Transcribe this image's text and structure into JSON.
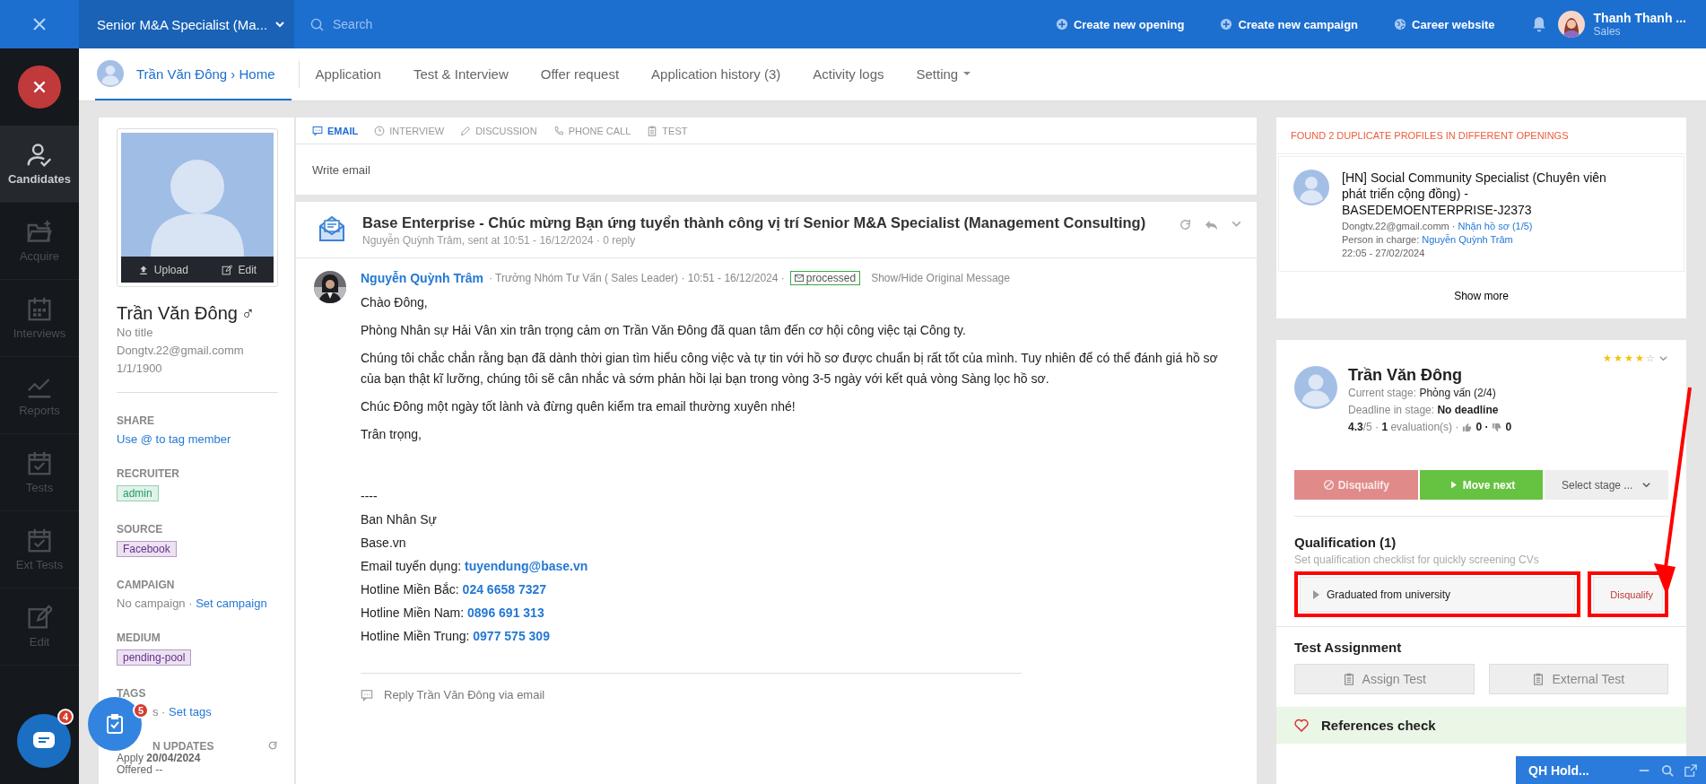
{
  "topbar": {
    "opening": "Senior M&A Specialist (Ma...",
    "search_placeholder": "Search",
    "actions": [
      {
        "label": "Create new opening",
        "kind": "plus"
      },
      {
        "label": "Create new campaign",
        "kind": "plus"
      },
      {
        "label": "Career website",
        "kind": "globe"
      }
    ],
    "user": {
      "name": "Thanh Thanh ...",
      "role": "Sales"
    }
  },
  "sidebar": {
    "items": [
      {
        "label": "Candidates",
        "kind": "user-check",
        "selected": true
      },
      {
        "label": "Acquire",
        "kind": "folder",
        "selected": false
      },
      {
        "label": "Interviews",
        "kind": "calendar",
        "selected": false
      },
      {
        "label": "Reports",
        "kind": "chart",
        "selected": false
      },
      {
        "label": "Tests",
        "kind": "calendar-check",
        "selected": false
      },
      {
        "label": "Ext Tests",
        "kind": "calendar-check",
        "selected": false
      },
      {
        "label": "Edit",
        "kind": "edit",
        "selected": false
      }
    ]
  },
  "subnav": {
    "tabs": [
      {
        "label": "Trần Văn Đông › Home",
        "kind": "profile",
        "selected": true
      },
      {
        "label": "Application",
        "kind": "link",
        "selected": false
      },
      {
        "label": "Test & Interview",
        "kind": "link",
        "selected": false
      },
      {
        "label": "Offer request",
        "kind": "link",
        "selected": false
      },
      {
        "label": "Application history (3)",
        "kind": "link",
        "selected": false
      },
      {
        "label": "Activity logs",
        "kind": "link",
        "selected": false
      },
      {
        "label": "Setting",
        "kind": "dropdown",
        "selected": false
      }
    ]
  },
  "profile": {
    "photo_actions": [
      {
        "label": "Upload",
        "kind": "upload"
      },
      {
        "label": "Edit",
        "kind": "edit"
      }
    ],
    "name": "Trần Văn Đông",
    "gender": "♂",
    "title": "No title",
    "email": "Dongtv.22@gmail.comm",
    "birthday": "1/1/1900",
    "sections": [
      {
        "heading": "SHARE",
        "kind": "link",
        "link": "Use @ to tag member"
      },
      {
        "heading": "RECRUITER",
        "kind": "tag",
        "tag": "admin",
        "color": "#1e9e63"
      },
      {
        "heading": "SOURCE",
        "kind": "tag",
        "tag": "Facebook",
        "color": "#6b2d8f"
      },
      {
        "heading": "CAMPAIGN",
        "kind": "text-link",
        "text": "No campaign ·",
        "link": "Set campaign"
      },
      {
        "heading": "MEDIUM",
        "kind": "tag",
        "tag": "pending-pool",
        "color": "#6b2d8f"
      },
      {
        "heading": "TAGS",
        "kind": "text-link",
        "text": "s ·",
        "link": "Set tags"
      },
      {
        "heading": "N UPDATES",
        "kind": "updates",
        "lines": [
          "Apply **20/04/2024**",
          "Offered --"
        ]
      }
    ]
  },
  "composer": {
    "tabs": [
      {
        "label": "EMAIL",
        "kind": "chat",
        "selected": true
      },
      {
        "label": "INTERVIEW",
        "kind": "clock",
        "selected": false
      },
      {
        "label": "DISCUSSION",
        "kind": "pencil",
        "selected": false
      },
      {
        "label": "PHONE CALL",
        "kind": "phone",
        "selected": false
      },
      {
        "label": "TEST",
        "kind": "clipboard",
        "selected": false
      }
    ],
    "placeholder": "Write email"
  },
  "email": {
    "subject": "Base Enterprise - Chúc mừng Bạn ứng tuyển thành công vị trí Senior M&A Specialist (Management Consulting)",
    "meta": "Nguyễn Quỳnh Trâm, sent at 10:51 - 16/12/2024 · 0 reply",
    "sender": "Nguyễn Quỳnh Trâm",
    "sender_info": "· Trưởng Nhóm Tư Vấn ( Sales Leader) · 10:51 - 16/12/2024 ·",
    "status": "processed",
    "toggle": "Show/Hide Original Message",
    "paragraphs": [
      "Chào Đông,",
      "Phòng Nhân sự Hải Vân xin trân trọng cảm ơn Trần Văn Đông đã quan tâm đến cơ hội công việc tại Công ty.",
      "Chúng tôi chắc chắn rằng bạn đã dành thời gian tìm hiểu công việc và tự tin với hồ sơ được chuẩn bị rất tốt của mình. Tuy nhiên để có thể đánh giá hồ sơ của bạn thật kĩ lưỡng, chúng tôi sẽ cân nhắc và sớm phản hồi lại bạn trong vòng 3-5 ngày với kết quả vòng Sàng lọc hồ sơ.",
      "Chúc Đông một ngày tốt lành và đừng quên kiểm tra email thường xuyên nhé!",
      "Trân trọng,"
    ],
    "signature": [
      {
        "label": "----"
      },
      {
        "label": "Ban Nhân Sự"
      },
      {
        "label": "Base.vn"
      },
      {
        "label": "Email tuyển dụng:",
        "value": "tuyendung@base.vn"
      },
      {
        "label": "Hotline Miền Bắc:",
        "value": "024 6658 7327"
      },
      {
        "label": "Hotline Miền Nam:",
        "value": "0896 691 313"
      },
      {
        "label": "Hotline Miền Trung:",
        "value": "0977 575 309"
      }
    ],
    "reply": "Reply Trần Văn Đông via email"
  },
  "duplicates": {
    "title": "FOUND 2 DUPLICATE PROFILES IN DIFFERENT OPENINGS",
    "items": [
      {
        "opening": "[HN] Social Community Specialist (Chuyên viên phát triển cộng đồng) - BASEDEMOENTERPRISE-J2373",
        "email": "Dongtv.22@gmail.comm ·",
        "stage": "Nhận hồ sơ (1/5)",
        "person_label": "Person in charge:",
        "person": "Nguyễn Quỳnh Trâm",
        "time": "22:05 - 27/02/2024"
      }
    ],
    "more": "Show more"
  },
  "candidate": {
    "stars": 4,
    "name": "Trần Văn Đông",
    "stage_label": "Current stage:",
    "stage": "Phỏng vấn (2/4)",
    "deadline_label": "Deadline in stage:",
    "deadline": "No deadline",
    "score": "4.3",
    "score_of": "/5 ·",
    "evaluations": "1",
    "evaluations_label": "evaluation(s) ·",
    "likes": "0 ·",
    "dislikes": "0",
    "buttons": [
      {
        "label": "Disqualify",
        "kind": "disqualify"
      },
      {
        "label": "Move next",
        "kind": "next"
      },
      {
        "label": "Select stage ...",
        "kind": "select"
      }
    ],
    "qualification": {
      "title": "Qualification (1)",
      "hint": "Set qualification checklist for quickly screening CVs",
      "items": [
        {
          "label": "Graduated from university",
          "action": "Disqualify",
          "highlighted": true
        }
      ]
    },
    "tests": {
      "title": "Test Assignment",
      "buttons": [
        "Assign Test",
        "External Test"
      ]
    },
    "references": "References check"
  },
  "fabs": {
    "chat_badge": "4",
    "tasks_badge": "5"
  },
  "chat_widget": {
    "title": "QH Hold..."
  }
}
